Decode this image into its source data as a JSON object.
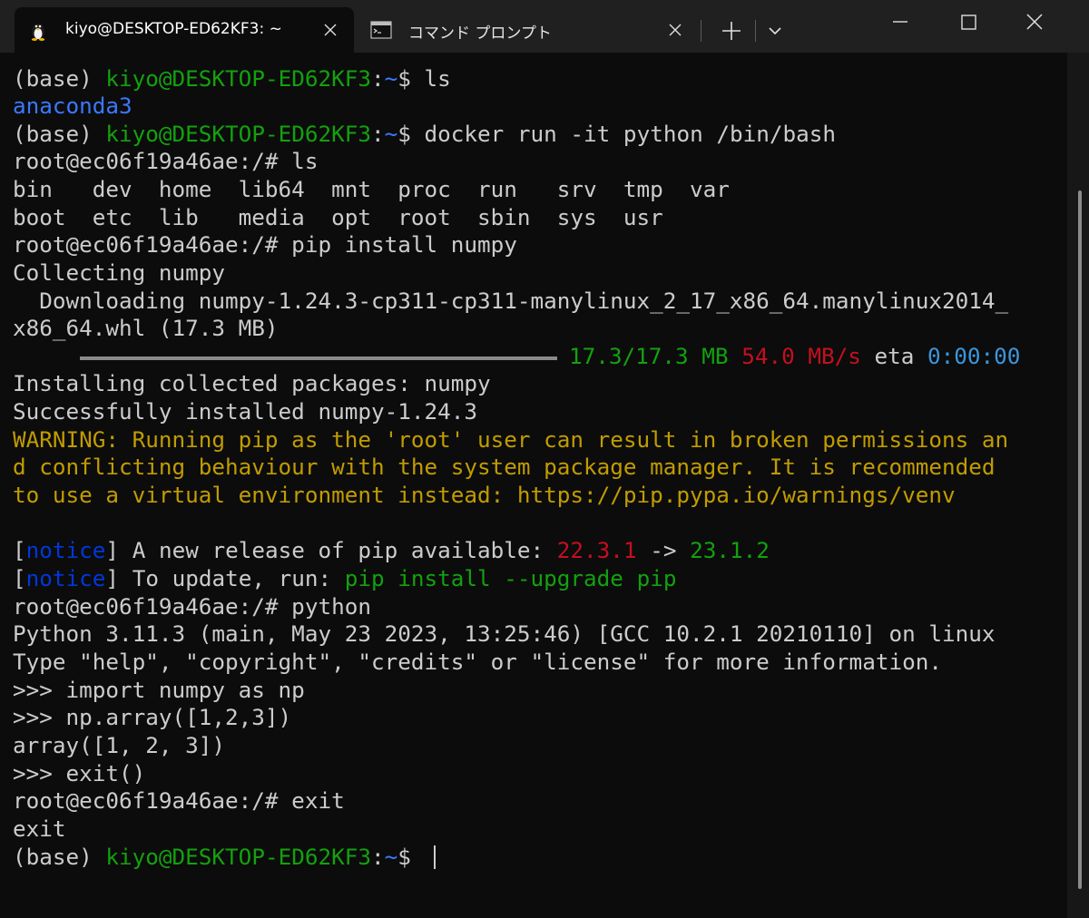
{
  "tabs": [
    {
      "label": "kiyo@DESKTOP-ED62KF3: ~",
      "icon": "linux-penguin-icon"
    },
    {
      "label": "コマンド プロンプト",
      "icon": "command-prompt-icon"
    }
  ],
  "colors": {
    "background": "#0c0c0c",
    "titlebar": "#202020",
    "text": "#cccccc",
    "green": "#13a10e",
    "blue": "#3b78ff",
    "dark_blue": "#0037da",
    "red": "#c50f1f",
    "yellow": "#c19c00",
    "cyan": "#3a96dd"
  },
  "progress": {
    "fraction": 1.0
  },
  "terminal": {
    "prompt_base": "(base) ",
    "prompt_user": "kiyo@DESKTOP-ED62KF3",
    "prompt_colon": ":",
    "prompt_tilde": "~",
    "prompt_dollar": "$ ",
    "cmd1": "ls",
    "out_anaconda": "anaconda3",
    "cmd2": "docker run -it python /bin/bash",
    "root_ls": "root@ec06f19a46ae:/# ls",
    "dirs1": "bin   dev  home  lib64  mnt  proc  run   srv  tmp  var",
    "dirs2": "boot  etc  lib   media  opt  root  sbin  sys  usr",
    "root_pip": "root@ec06f19a46ae:/# pip install numpy",
    "collecting": "Collecting numpy",
    "downloading": "  Downloading numpy-1.24.3-cp311-cp311-manylinux_2_17_x86_64.manylinux2014_",
    "wheel": "x86_64.whl (17.3 MB)",
    "prog_size": "17.3/17.3 MB",
    "prog_speed": "54.0 MB/s",
    "prog_eta_label": "eta",
    "prog_eta": "0:00:00",
    "installing": "Installing collected packages: numpy",
    "success": "Successfully installed numpy-1.24.3",
    "warn1": "WARNING: Running pip as the 'root' user can result in broken permissions an",
    "warn2": "d conflicting behaviour with the system package manager. It is recommended",
    "warn3": "to use a virtual environment instead: https://pip.pypa.io/warnings/venv",
    "br_open": "[",
    "notice": "notice",
    "br_close": "]",
    "notice1_text": " A new release of pip available: ",
    "old_ver": "22.3.1",
    "arrow": " -> ",
    "new_ver": "23.1.2",
    "notice2_text": " To update, run: ",
    "upgrade_cmd": "pip install --upgrade pip",
    "root_python": "root@ec06f19a46ae:/# python",
    "py_banner": "Python 3.11.3 (main, May 23 2023, 13:25:46) [GCC 10.2.1 20210110] on linux",
    "py_type": "Type \"help\", \"copyright\", \"credits\" or \"license\" for more information.",
    "py_import": ">>> import numpy as np",
    "py_array_cmd": ">>> np.array([1,2,3])",
    "py_array_out": "array([1, 2, 3])",
    "py_exit": ">>> exit()",
    "root_exit": "root@ec06f19a46ae:/# exit",
    "exit_out": "exit"
  }
}
